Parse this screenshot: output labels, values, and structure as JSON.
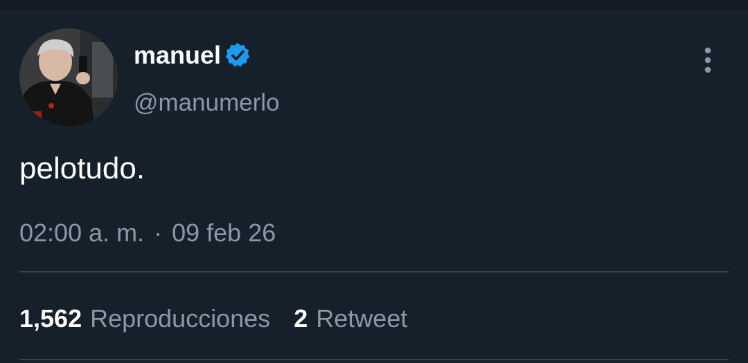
{
  "author": {
    "display_name": "manuel",
    "handle": "@manumerlo",
    "verified": true,
    "verified_color": "#1d9bf0"
  },
  "tweet": {
    "text": "pelotudo.",
    "time": "02:00 a. m.",
    "separator": "·",
    "date": "09 feb 26"
  },
  "stats": [
    {
      "value": "1,562",
      "label": "Reproducciones"
    },
    {
      "value": "2",
      "label": "Retweet"
    }
  ],
  "icons": {
    "verified": "verified-badge-icon",
    "more": "more-vertical-icon"
  },
  "colors": {
    "background": "#15202b",
    "primary_text": "#ffffff",
    "secondary_text": "#8b98a5",
    "divider": "#38444d"
  }
}
